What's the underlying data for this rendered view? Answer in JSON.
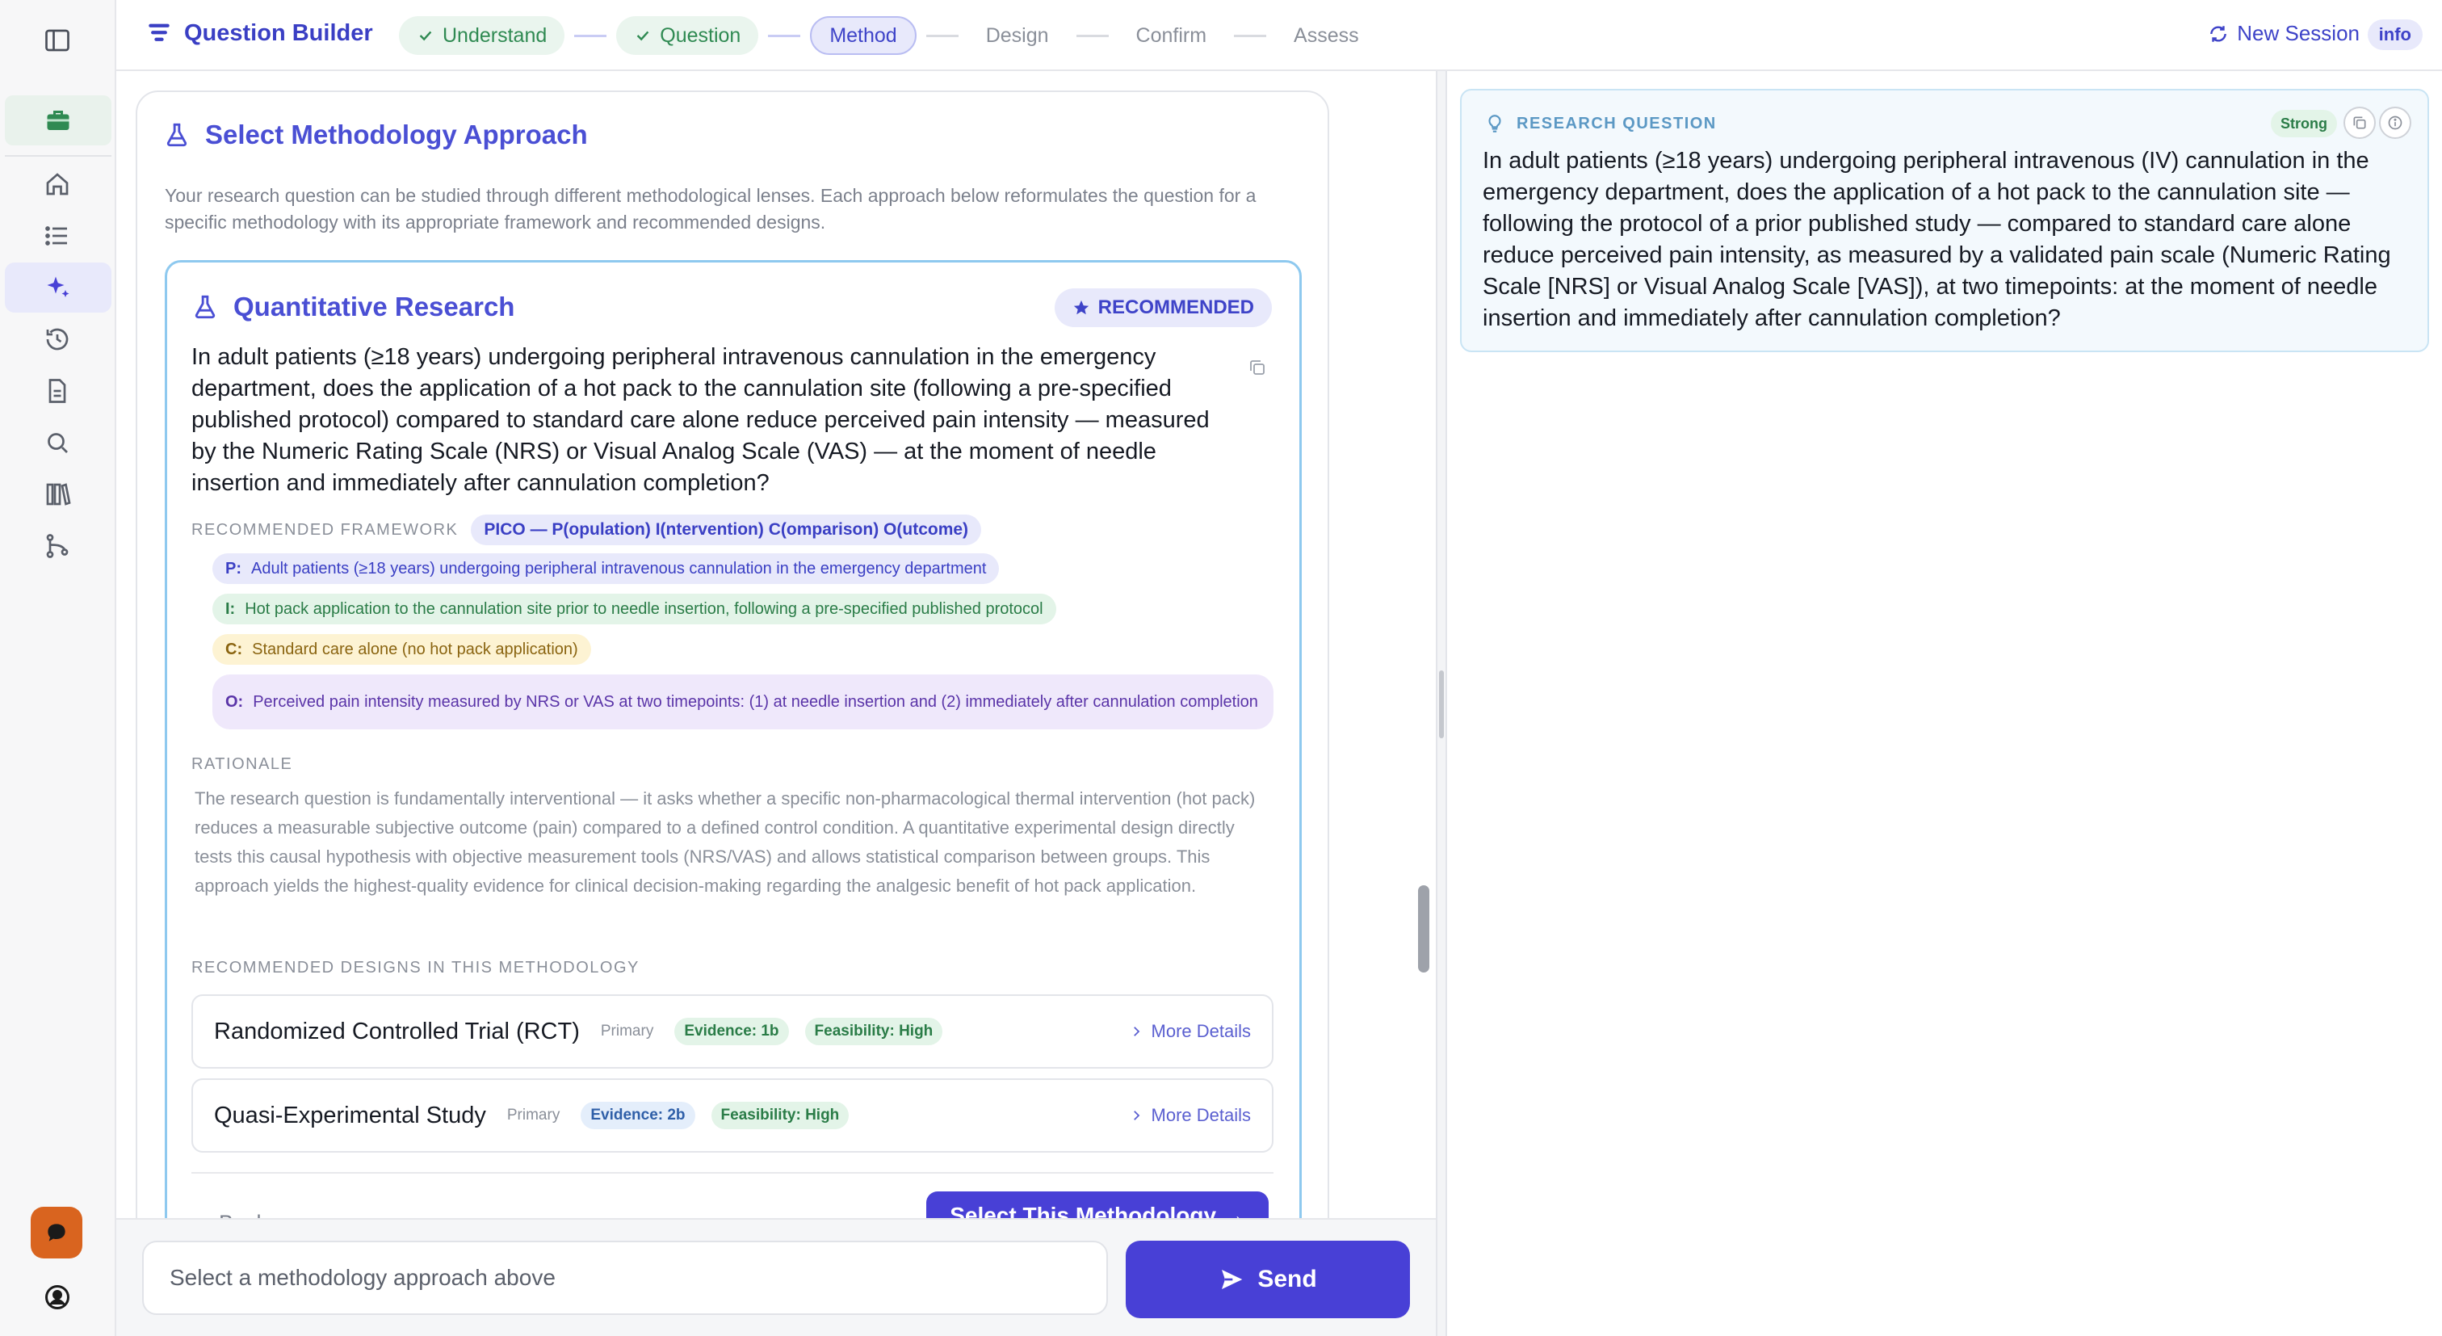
{
  "app": {
    "brand": "Question Builder",
    "new_session_label": "New Session",
    "info_badge": "info",
    "accent_color": "#4840d6"
  },
  "steps": [
    {
      "label": "Understand",
      "state": "done"
    },
    {
      "label": "Question",
      "state": "done"
    },
    {
      "label": "Method",
      "state": "current"
    },
    {
      "label": "Design",
      "state": "upcoming"
    },
    {
      "label": "Confirm",
      "state": "upcoming"
    },
    {
      "label": "Assess",
      "state": "upcoming"
    }
  ],
  "sidebar": {
    "icons": [
      "sidebar-toggle-icon",
      "briefcase-icon",
      "home-icon",
      "list-icon",
      "sparkles-icon",
      "history-icon",
      "document-icon",
      "search-icon",
      "library-icon",
      "git-branch-icon",
      "chat-icon",
      "account-icon"
    ]
  },
  "methodology": {
    "title": "Select Methodology Approach",
    "intro": "Your research question can be studied through different methodological lenses. Each approach below reformulates the question for a specific methodology with its appropriate framework and recommended designs.",
    "card": {
      "title": "Quantitative Research",
      "badge": "RECOMMENDED",
      "question": "In adult patients (≥18 years) undergoing peripheral intravenous cannulation in the emergency department, does the application of a hot pack to the cannulation site (following a pre-specified published protocol) compared to standard care alone reduce perceived pain intensity — measured by the Numeric Rating Scale (NRS) or Visual Analog Scale (VAS) — at the moment of needle insertion and immediately after cannulation completion?",
      "framework_label": "RECOMMENDED FRAMEWORK",
      "framework": "PICO — P(opulation) I(ntervention) C(omparison) O(utcome)",
      "pico": {
        "p_key": "P:",
        "p": "Adult patients (≥18 years) undergoing peripheral intravenous cannulation in the emergency department",
        "i_key": "I:",
        "i": "Hot pack application to the cannulation site prior to needle insertion, following a pre-specified published protocol",
        "c_key": "C:",
        "c": "Standard care alone (no hot pack application)",
        "o_key": "O:",
        "o": "Perceived pain intensity measured by NRS or VAS at two timepoints: (1) at needle insertion and (2) immediately after cannulation completion"
      },
      "rationale_label": "RATIONALE",
      "rationale": "The research question is fundamentally interventional — it asks whether a specific non-pharmacological thermal intervention (hot pack) reduces a measurable subjective outcome (pain) compared to a defined control condition. A quantitative experimental design directly tests this causal hypothesis with objective measurement tools (NRS/VAS) and allows statistical comparison between groups. This approach yields the highest-quality evidence for clinical decision-making regarding the analgesic benefit of hot pack application.",
      "designs_label": "RECOMMENDED DESIGNS IN THIS METHODOLOGY",
      "designs": [
        {
          "name": "Randomized Controlled Trial (RCT)",
          "type": "Primary",
          "evidence": "Evidence: 1b",
          "feasibility": "Feasibility: High",
          "more": "More Details"
        },
        {
          "name": "Quasi-Experimental Study",
          "type": "Primary",
          "evidence": "Evidence: 2b",
          "feasibility": "Feasibility: High",
          "more": "More Details"
        }
      ],
      "back_label": "Back",
      "select_label": "Select This Methodology →"
    }
  },
  "composer": {
    "placeholder": "Select a methodology approach above",
    "send_label": "Send"
  },
  "research_question": {
    "label": "RESEARCH QUESTION",
    "strength": "Strong",
    "text": "In adult patients (≥18 years) undergoing peripheral intravenous (IV) cannulation in the emergency department, does the application of a hot pack to the cannulation site — following the protocol of a prior published study — compared to standard care alone reduce perceived pain intensity, as measured by a validated pain scale (Numeric Rating Scale [NRS] or Visual Analog Scale [VAS]), at two timepoints: at the moment of needle insertion and immediately after cannulation completion?"
  }
}
